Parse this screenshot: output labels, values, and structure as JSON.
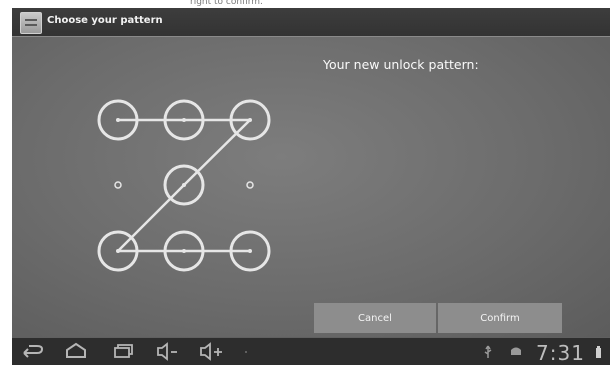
{
  "caption_fragment": "right to confirm.",
  "window": {
    "title": "Choose your pattern",
    "app_icon": "settings-list-icon"
  },
  "main": {
    "instruction": "Your new unlock pattern:",
    "pattern": {
      "grid": "3x3",
      "selected_dots": [
        1,
        2,
        3,
        5,
        7,
        8,
        9
      ],
      "unselected_dots": [
        4,
        6
      ],
      "sequence": [
        1,
        2,
        3,
        5,
        7,
        8,
        9
      ]
    }
  },
  "buttons": {
    "cancel": "Cancel",
    "confirm": "Confirm"
  },
  "navbar": {
    "icons": [
      "back-icon",
      "home-icon",
      "recent-apps-icon",
      "volume-down-icon",
      "volume-up-icon",
      "usb-icon",
      "android-debug-icon",
      "battery-icon"
    ],
    "time": "7:31"
  },
  "colors": {
    "title_bar": "#363636",
    "content_bg": "#6f6f6f",
    "pattern_stroke": "#e6e6e6",
    "button_bg": "#8d8d8d",
    "nav_bar": "#2d2d2d"
  }
}
